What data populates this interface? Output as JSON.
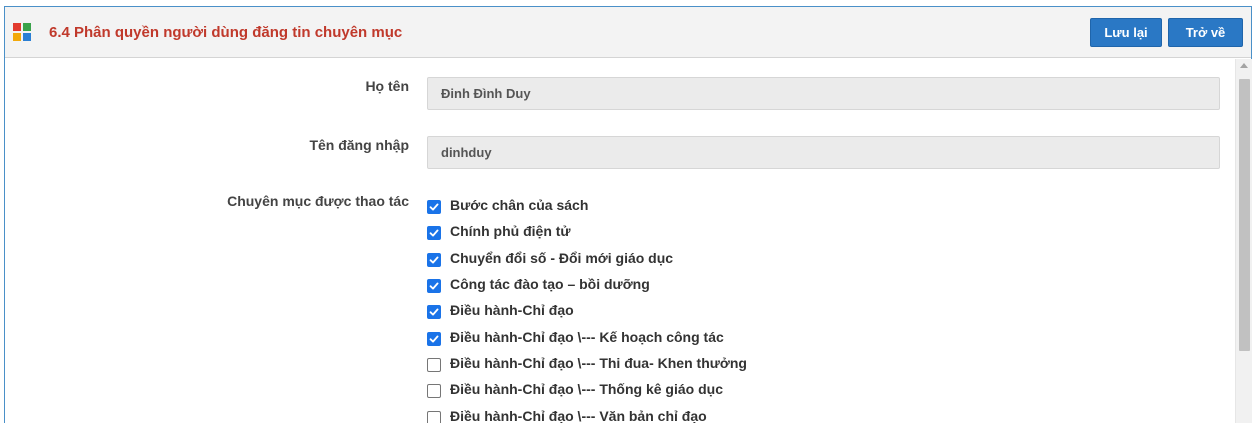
{
  "header": {
    "title": "6.4 Phân quyền người dùng đăng tin chuyên mục",
    "save_label": "Lưu lại",
    "back_label": "Trở về"
  },
  "form": {
    "fullname_label": "Họ tên",
    "fullname_value": "Đinh Đình Duy",
    "username_label": "Tên đăng nhập",
    "username_value": "dinhduy",
    "categories_label": "Chuyên mục được thao tác"
  },
  "categories": [
    {
      "label": "Bước chân của sách",
      "checked": true
    },
    {
      "label": "Chính phủ điện tử",
      "checked": true
    },
    {
      "label": "Chuyển đổi số - Đổi mới giáo dục",
      "checked": true
    },
    {
      "label": "Công tác đào tạo – bồi dưỡng",
      "checked": true
    },
    {
      "label": "Điều hành-Chỉ đạo",
      "checked": true
    },
    {
      "label": "Điều hành-Chỉ đạo \\--- Kế hoạch công tác",
      "checked": true
    },
    {
      "label": "Điều hành-Chỉ đạo \\--- Thi đua- Khen thưởng",
      "checked": false
    },
    {
      "label": "Điều hành-Chỉ đạo \\--- Thống kê giáo dục",
      "checked": false
    },
    {
      "label": "Điều hành-Chỉ đạo \\--- Văn bản chỉ đạo",
      "checked": false
    }
  ],
  "icons": {
    "header": "app-grid-icon",
    "checkbox": "checkmark-icon",
    "scroll_up": "scroll-up-arrow-icon"
  },
  "colors": {
    "title": "#c0392b",
    "button": "#2a78c5",
    "checkbox": "#1a73e8",
    "border": "#4a90c8"
  }
}
